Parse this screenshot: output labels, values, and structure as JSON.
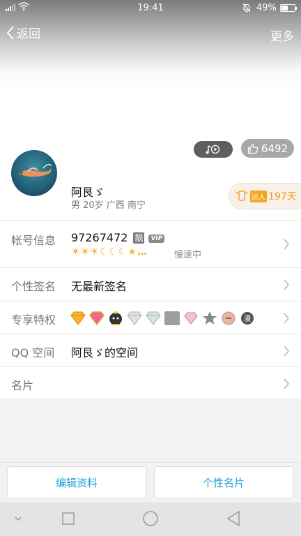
{
  "status_bar": {
    "time": "19:41",
    "battery": "49%",
    "battery_level": 0.49
  },
  "nav": {
    "back_label": "返回",
    "more_label": "更多"
  },
  "likes": {
    "count": "6492"
  },
  "profile": {
    "nickname": "阿艮ゞ",
    "subinfo": "男 20岁 广西 南宁",
    "active_tag": "达人",
    "active_days": "197天"
  },
  "rows": {
    "account": {
      "label": "帐号信息",
      "qq": "97267472",
      "liang": "靓",
      "vip": "VIP",
      "speed": "慢速中",
      "level_icons": [
        "sun",
        "sun",
        "sun",
        "moon",
        "moon",
        "moon",
        "star",
        "ellipsis"
      ]
    },
    "signature": {
      "label": "个性签名",
      "value": "无最新签名"
    },
    "privileges": {
      "label": "专享特权",
      "icons": [
        "gold-diamond-icon",
        "pink-diamond-icon",
        "penguin-icon",
        "silver-diamond-icon",
        "silver-diamond-2-icon",
        "gray-square-icon",
        "pink-diamond-small-icon",
        "gray-star-icon",
        "red-circle-icon",
        "comic-icon"
      ]
    },
    "qzone": {
      "label": "QQ 空间",
      "value": "阿艮ゞ的空间"
    },
    "card": {
      "label": "名片"
    }
  },
  "actions": {
    "edit_profile": "编辑资料",
    "personal_card": "个性名片"
  },
  "colors": {
    "accent": "#1a9fd8",
    "active_orange": "#f39c12"
  }
}
